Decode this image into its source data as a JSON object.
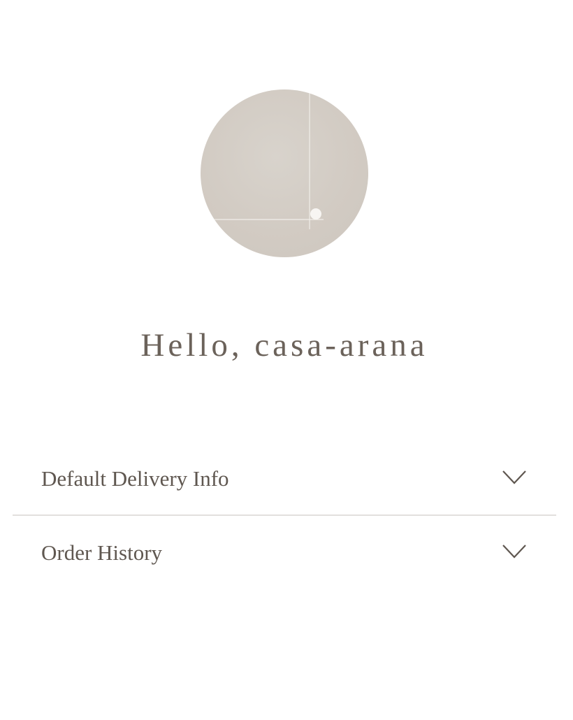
{
  "profile": {
    "avatar_icon": "abstract-avatar-icon",
    "avatar_color": "#d3ccc4",
    "greeting": "Hello, casa-arana"
  },
  "sections": [
    {
      "label": "Default Delivery Info",
      "icon": "chevron-down-icon"
    },
    {
      "label": "Order History",
      "icon": "chevron-down-icon"
    }
  ],
  "colors": {
    "text": "#6b625a",
    "divider": "#e2e0de",
    "background": "#ffffff"
  }
}
